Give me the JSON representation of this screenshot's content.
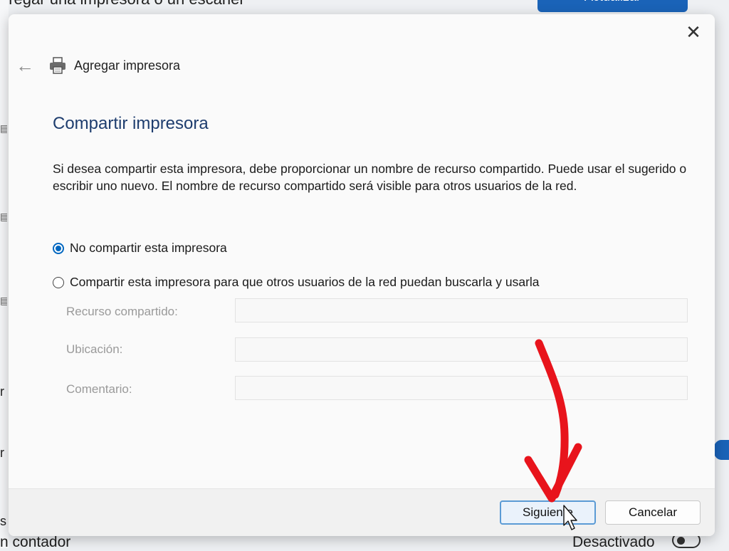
{
  "background": {
    "top_text": "gregar una impresora o un escáner",
    "top_button": "Actualizar",
    "left_letters": [
      "r",
      "r",
      "s"
    ],
    "bottom_left_text": "n contador",
    "bottom_right_text": "Desactivado"
  },
  "dialog": {
    "header_title": "Agregar impresora",
    "section_title": "Compartir impresora",
    "description": "Si desea compartir esta impresora, debe proporcionar un nombre de recurso compartido. Puede usar el sugerido o escribir uno nuevo. El nombre de recurso compartido será visible para otros usuarios de la red.",
    "options": [
      {
        "label": "No compartir esta impresora",
        "selected": true
      },
      {
        "label": "Compartir esta impresora para que otros usuarios de la red puedan buscarla y usarla",
        "selected": false
      }
    ],
    "fields": [
      {
        "label": "Recurso compartido:",
        "value": ""
      },
      {
        "label": "Ubicación:",
        "value": ""
      },
      {
        "label": "Comentario:",
        "value": ""
      }
    ],
    "next_button": "Siguiente",
    "cancel_button": "Cancelar"
  },
  "colors": {
    "accent": "#0067c0",
    "title": "#1e3d6e",
    "annotation_arrow": "#e8141c"
  },
  "icons": {
    "close": "close-icon",
    "back": "back-arrow-icon",
    "printer": "printer-icon"
  }
}
